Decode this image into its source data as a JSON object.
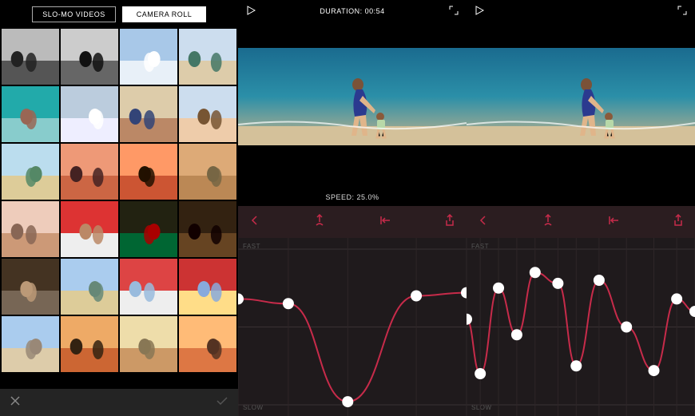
{
  "colors": {
    "accent": "#c72b4a",
    "bg": "#1a1a1a"
  },
  "panelA": {
    "tabs": {
      "slomo": "SLO-MO VIDEOS",
      "other": "CAMERA ROLL"
    },
    "active_tab": "other",
    "thumbs": [
      {
        "kind": "bw_couple"
      },
      {
        "kind": "bw_kiss"
      },
      {
        "kind": "sky"
      },
      {
        "kind": "beach_family"
      },
      {
        "kind": "selfie_water"
      },
      {
        "kind": "clouds"
      },
      {
        "kind": "couple_face"
      },
      {
        "kind": "couple_beach"
      },
      {
        "kind": "beach_family2"
      },
      {
        "kind": "sunset_crowd"
      },
      {
        "kind": "sunset_silhouette"
      },
      {
        "kind": "man_smile"
      },
      {
        "kind": "boy_cry"
      },
      {
        "kind": "mom_kid"
      },
      {
        "kind": "xmas"
      },
      {
        "kind": "dark_party"
      },
      {
        "kind": "woman_smile"
      },
      {
        "kind": "beach_family3"
      },
      {
        "kind": "dad_kid"
      },
      {
        "kind": "dad_kid2"
      },
      {
        "kind": "beach_walk"
      },
      {
        "kind": "family_sunset"
      },
      {
        "kind": "couple_hug"
      },
      {
        "kind": "couple_sunset"
      }
    ],
    "close_icon": "✕",
    "confirm_icon": "✓"
  },
  "panelB": {
    "duration_label": "DURATION: 00:54",
    "speed_label": "SPEED: 25.0%",
    "graph_y_fast": "FAST",
    "graph_y_slow": "SLOW",
    "toolbar": {
      "back_icon": "back",
      "insert_icon": "insert-point",
      "jumpstart_icon": "jump-start",
      "share_icon": "share"
    },
    "curve": {
      "points": [
        {
          "x": 0.0,
          "y": 0.32
        },
        {
          "x": 0.22,
          "y": 0.35
        },
        {
          "x": 0.48,
          "y": 0.98
        },
        {
          "x": 0.78,
          "y": 0.3
        },
        {
          "x": 1.0,
          "y": 0.28
        }
      ]
    }
  },
  "panelC": {
    "graph_y_fast": "FAST",
    "graph_y_slow": "SLOW",
    "toolbar": {
      "back_icon": "back",
      "insert_icon": "insert-point",
      "jumpstart_icon": "jump-start",
      "share_icon": "share"
    },
    "curve": {
      "points": [
        {
          "x": 0.0,
          "y": 0.45
        },
        {
          "x": 0.06,
          "y": 0.8
        },
        {
          "x": 0.14,
          "y": 0.25
        },
        {
          "x": 0.22,
          "y": 0.55
        },
        {
          "x": 0.3,
          "y": 0.15
        },
        {
          "x": 0.4,
          "y": 0.22
        },
        {
          "x": 0.48,
          "y": 0.75
        },
        {
          "x": 0.58,
          "y": 0.2
        },
        {
          "x": 0.7,
          "y": 0.5
        },
        {
          "x": 0.82,
          "y": 0.78
        },
        {
          "x": 0.92,
          "y": 0.32
        },
        {
          "x": 1.0,
          "y": 0.4
        }
      ]
    }
  }
}
